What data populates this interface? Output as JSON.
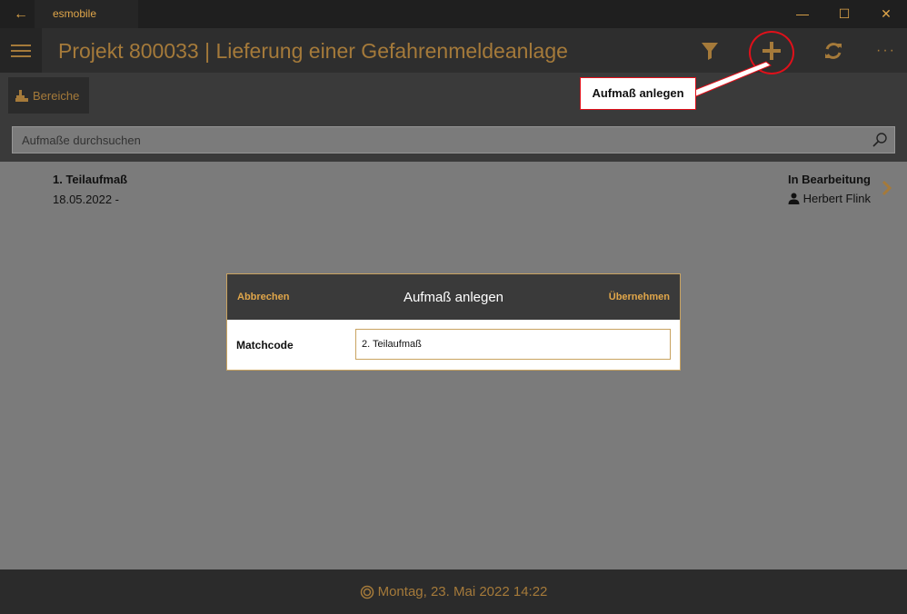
{
  "window": {
    "title": "esmobile",
    "back_glyph": "←",
    "minimize_glyph": "—",
    "maximize_glyph": "☐",
    "close_glyph": "✕"
  },
  "header": {
    "title": "Projekt 800033  |  Lieferung einer Gefahrenmeldeanlage",
    "more_glyph": "···",
    "icons": [
      "menu-icon",
      "filter-icon",
      "add-icon",
      "refresh-icon",
      "more-icon"
    ]
  },
  "toolbar": {
    "bereiche_label": "Bereiche"
  },
  "search": {
    "placeholder": "Aufmaße durchsuchen",
    "value": ""
  },
  "list": {
    "items": [
      {
        "title": "1. Teilaufmaß",
        "date": "18.05.2022 -",
        "status": "In Bearbeitung",
        "user": "Herbert Flink"
      }
    ]
  },
  "dialog": {
    "cancel_label": "Abbrechen",
    "title": "Aufmaß anlegen",
    "apply_label": "Übernehmen",
    "field_label": "Matchcode",
    "field_value": "2. Teilaufmaß"
  },
  "annotation": {
    "label": "Aufmaß anlegen"
  },
  "footer": {
    "datetime": "Montag, 23. Mai 2022 14:22"
  },
  "colors": {
    "accent": "#e0a64a",
    "accent_dim": "#a57a3a",
    "annotation_red": "#e0101a",
    "overlay": "#7b7b7b"
  }
}
